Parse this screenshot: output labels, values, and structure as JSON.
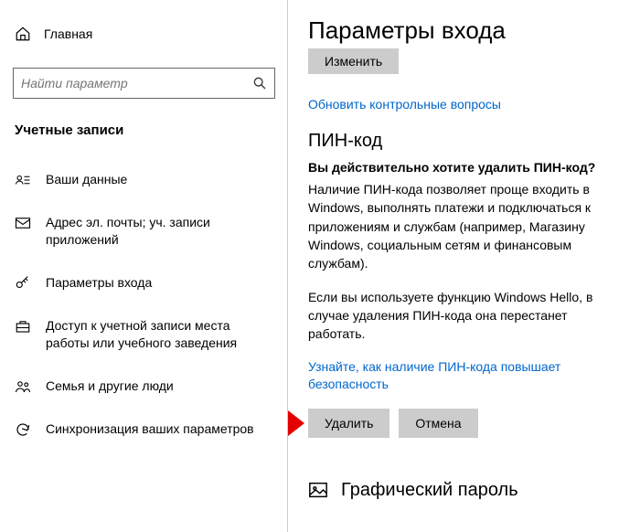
{
  "sidebar": {
    "home_label": "Главная",
    "search_placeholder": "Найти параметр",
    "section_title": "Учетные записи",
    "items": [
      {
        "label": "Ваши данные"
      },
      {
        "label": "Адрес эл. почты; уч. записи приложений"
      },
      {
        "label": "Параметры входа"
      },
      {
        "label": "Доступ к учетной записи места работы или учебного заведения"
      },
      {
        "label": "Семья и другие люди"
      },
      {
        "label": "Синхронизация ваших параметров"
      }
    ]
  },
  "main": {
    "title": "Параметры входа",
    "change_btn": "Изменить",
    "update_questions_link": "Обновить контрольные вопросы",
    "pin": {
      "heading": "ПИН-код",
      "confirm_q": "Вы действительно хотите удалить ПИН-код?",
      "body1": "Наличие ПИН-кода позволяет проще входить в Windows, выполнять платежи и подключаться к приложениям и службам (например, Магазину Windows, социальным сетям и финансовым службам).",
      "body2": "Если вы используете функцию Windows Hello, в случае удаления ПИН-кода она перестанет работать.",
      "learn_link": "Узнайте, как наличие ПИН-кода повышает безопасность",
      "delete_btn": "Удалить",
      "cancel_btn": "Отмена"
    },
    "picture_pwd_heading": "Графический пароль"
  }
}
